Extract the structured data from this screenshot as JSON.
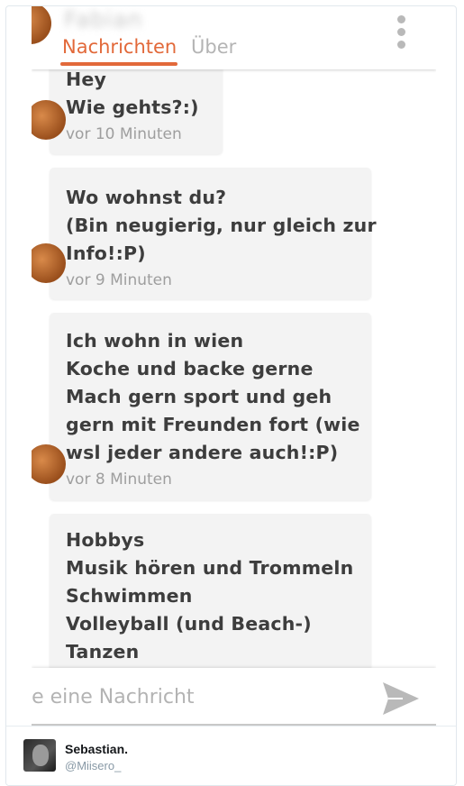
{
  "header": {
    "contact_name": "Fabian",
    "tabs": [
      {
        "label": "Nachrichten"
      },
      {
        "label": "Über"
      }
    ]
  },
  "messages": [
    {
      "lines": [
        "Hey",
        "Wie gehts?:)"
      ],
      "time": "vor 10 Minuten"
    },
    {
      "lines": [
        "Wo wohnst du?",
        "(Bin neugierig, nur gleich zur",
        "Info!:P)"
      ],
      "time": "vor 9 Minuten"
    },
    {
      "lines": [
        "Ich wohn in wien",
        "Koche und backe gerne",
        "Mach gern sport und geh",
        "gern mit Freunden fort (wie",
        "wsl jeder andere auch!:P)"
      ],
      "time": "vor 8 Minuten"
    },
    {
      "lines": [
        "Hobbys",
        "Musik hören und Trommeln",
        "Schwimmen",
        "Volleyball (und Beach-)",
        "Tanzen"
      ]
    }
  ],
  "compose": {
    "placeholder": "le eine Nachricht"
  },
  "author": {
    "name": "Sebastian.",
    "handle": "@Miisero_"
  },
  "colors": {
    "accent": "#e2693a",
    "bubble": "#f3f3f3",
    "send_icon": "#b9b9b9"
  },
  "icons": {
    "more": "more-vertical-icon",
    "send": "send-icon"
  }
}
